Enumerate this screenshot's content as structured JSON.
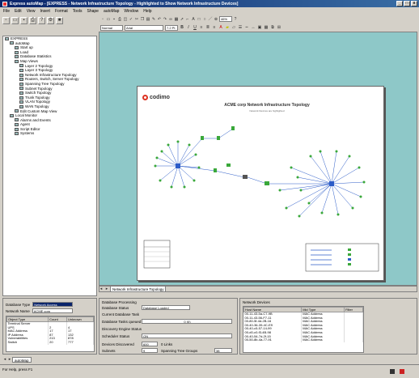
{
  "window": {
    "title": "Express autoMap - [EXPRESS - Network Infrastructure Topology - Highlighted to Show Network Infrastructure Devices]"
  },
  "menu": [
    "File",
    "Edit",
    "View",
    "Insert",
    "Format",
    "Tools",
    "Shape",
    "autoMap",
    "Window",
    "Help"
  ],
  "toolbar": {
    "style_select": "Normal",
    "font_select": "Arial",
    "size_select": "7.2 Pt",
    "zoom_select": "46%"
  },
  "tree": {
    "items": [
      {
        "label": "EXPRESS",
        "level": 0
      },
      {
        "label": "autoMap",
        "level": 1
      },
      {
        "label": "Start up",
        "level": 2
      },
      {
        "label": "Load",
        "level": 2
      },
      {
        "label": "Database Statistics",
        "level": 2
      },
      {
        "label": "Map Views",
        "level": 2
      },
      {
        "label": "Layer 2 Topology",
        "level": 3
      },
      {
        "label": "Layer 3 Topology",
        "level": 3
      },
      {
        "label": "Network Infrastructure Topology",
        "level": 3
      },
      {
        "label": "Routers, Switch, Server Topology",
        "level": 3
      },
      {
        "label": "Spanning Tree Topology",
        "level": 3
      },
      {
        "label": "Subnet Topology",
        "level": 3
      },
      {
        "label": "Switch Topology",
        "level": 3
      },
      {
        "label": "Trunk Topology",
        "level": 3
      },
      {
        "label": "VLAN Topology",
        "level": 3
      },
      {
        "label": "WAN Topology",
        "level": 3
      },
      {
        "label": "Edit Custom Map View",
        "level": 2
      },
      {
        "label": "Local Monitor",
        "level": 1
      },
      {
        "label": "Alarms and Events",
        "level": 2
      },
      {
        "label": "Agent",
        "level": 2
      },
      {
        "label": "Script Editor",
        "level": 2
      },
      {
        "label": "Systems",
        "level": 2
      }
    ]
  },
  "canvas": {
    "logo": "codimo",
    "diagram_title": "ACME corp Network Infrastructure Topology",
    "diagram_subtitle": "Network Devices are highlighted"
  },
  "tabs": {
    "active": "Network Infrastructure Topology"
  },
  "bottom_left": {
    "db_type_label": "Database Type",
    "db_type_value": "Network Access",
    "network_name_label": "Network Name",
    "network_name_value": "ACME corp",
    "headers": [
      "Object Type",
      "Count",
      "Unknown"
    ],
    "rows": [
      [
        "Terminal Server",
        "",
        ""
      ],
      [
        "UPS",
        "2",
        "4"
      ],
      [
        "MAC Address",
        "17",
        "17"
      ],
      [
        "IP Address",
        "87",
        "132"
      ],
      [
        "Vulnerabilities",
        "213",
        "878"
      ],
      [
        "Switch",
        "20",
        "777"
      ]
    ]
  },
  "bottom_mid": {
    "heading": "Database Processing",
    "rows": [
      {
        "label": "Database Status",
        "value": "Database Loaded"
      },
      {
        "label": "Current Database Task",
        "value": ""
      },
      {
        "label": "Database Tasks queued",
        "value": "0 (0)"
      },
      {
        "label": "Discovery Engine Status",
        "value": ""
      },
      {
        "label": "Scheduler Status",
        "value": "ON"
      },
      {
        "label": "Devices Discovered",
        "value": "600"
      },
      {
        "label": "Subnets",
        "value": "9"
      }
    ],
    "nodes_value": "0 Links",
    "spanning_label": "Spanning Tree Groups",
    "spanning_value": "38"
  },
  "bottom_right": {
    "heading": "Network Devices",
    "headers": [
      "Host Name",
      "Mid Type",
      "Filter"
    ],
    "rows": [
      [
        "00-11-43-5a-C7-9B",
        "MAC Address"
      ],
      [
        "00-11-43-56-F7-11",
        "MAC Address"
      ],
      [
        "00-80-5f-4d-2B-16",
        "MAC Address"
      ],
      [
        "00-40-36-39-4C-E9",
        "MAC Address"
      ],
      [
        "00-40-c5-57-14-99",
        "MAC Address"
      ],
      [
        "00-d0-c0-f3-4B-98",
        "MAC Address"
      ],
      [
        "00-40-54-7d-2f-15",
        "MAC Address"
      ],
      [
        "00-50-8b-4a-77-91",
        "MAC Address"
      ]
    ]
  },
  "bottom_tabs": [
    "autoMap"
  ],
  "status": {
    "text": "For Help, press F1"
  },
  "colors": {
    "titlebar": "#0a246a",
    "canvas_bg": "#8ec8c8",
    "node_green": "#3aa83a",
    "link_blue": "#2c5cc8"
  }
}
